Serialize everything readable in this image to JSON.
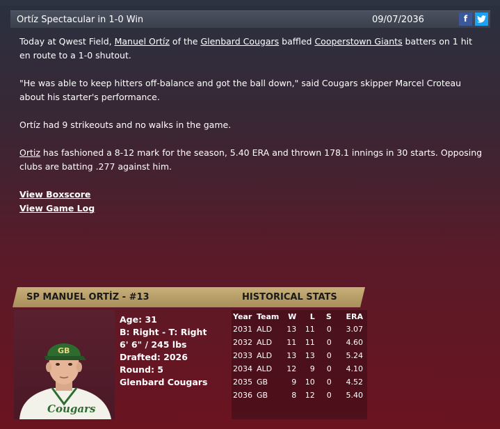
{
  "header": {
    "title": "Ortíz Spectacular in 1-0 Win",
    "date": "09/07/2036",
    "facebook_icon": "f",
    "twitter_icon": "t"
  },
  "article": {
    "p1_pre": "Today at Qwest Field, ",
    "p1_player": "Manuel Ortíz",
    "p1_mid1": " of the ",
    "p1_team": "Glenbard Cougars",
    "p1_mid2": " baffled ",
    "p1_opp": "Cooperstown Giants",
    "p1_post": " batters on 1 hit en route to a 1-0 shutout.",
    "p2": "\"He was able to keep hitters off-balance and got the ball down,\" said Cougars skipper Marcel Croteau about his starter's performance.",
    "p3": "Ortíz had 9 strikeouts and no walks in the game.",
    "p4_player": "Ortiz",
    "p4_post": " has fashioned a 8-12 mark for the season, 5.40 ERA and thrown 178.1 innings in 30 starts. Opposing clubs are batting .277 against him.",
    "link_boxscore": "View Boxscore",
    "link_gamelog": "View Game Log"
  },
  "player": {
    "header_name": "SP MANUEL ORTİZ - #13",
    "age": "Age: 31",
    "bats_throws": "B: Right - T: Right",
    "height_weight": "6' 6\" / 245 lbs",
    "drafted": "Drafted: 2026",
    "round": "Round: 5",
    "team": "Glenbard Cougars",
    "cap_logo": "GB",
    "jersey_text": "Cougars"
  },
  "stats": {
    "title": "HISTORICAL STATS",
    "headers": [
      "Year",
      "Team",
      "W",
      "L",
      "S",
      "ERA"
    ],
    "rows": [
      [
        "2031",
        "ALD",
        "13",
        "11",
        "0",
        "3.07"
      ],
      [
        "2032",
        "ALD",
        "11",
        "11",
        "0",
        "4.60"
      ],
      [
        "2033",
        "ALD",
        "13",
        "13",
        "0",
        "5.24"
      ],
      [
        "2034",
        "ALD",
        "12",
        "9",
        "0",
        "4.10"
      ],
      [
        "2035",
        "GB",
        "9",
        "10",
        "0",
        "4.52"
      ],
      [
        "2036",
        "GB",
        "8",
        "12",
        "0",
        "5.40"
      ]
    ]
  }
}
